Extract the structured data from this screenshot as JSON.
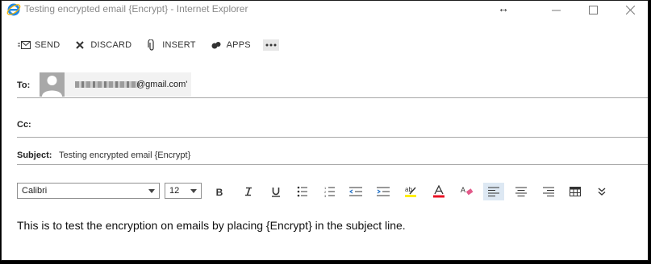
{
  "window": {
    "title": "Testing encrypted email {Encrypt} - Internet Explorer"
  },
  "toolbar": {
    "send": "SEND",
    "discard": "DISCARD",
    "insert": "INSERT",
    "apps": "APPS"
  },
  "fields": {
    "to_label": "To:",
    "to_recipient_visible": "@gmail.com'",
    "cc_label": "Cc:",
    "subject_label": "Subject:",
    "subject_value": "Testing encrypted email {Encrypt}"
  },
  "format": {
    "font": "Calibri",
    "size": "12"
  },
  "body": {
    "text": "This is to test the encryption on emails by placing {Encrypt} in the subject line."
  },
  "colors": {
    "highlight": "#ffee00",
    "font_color": "#e81123",
    "active_align_bg": "#dde8f3"
  }
}
